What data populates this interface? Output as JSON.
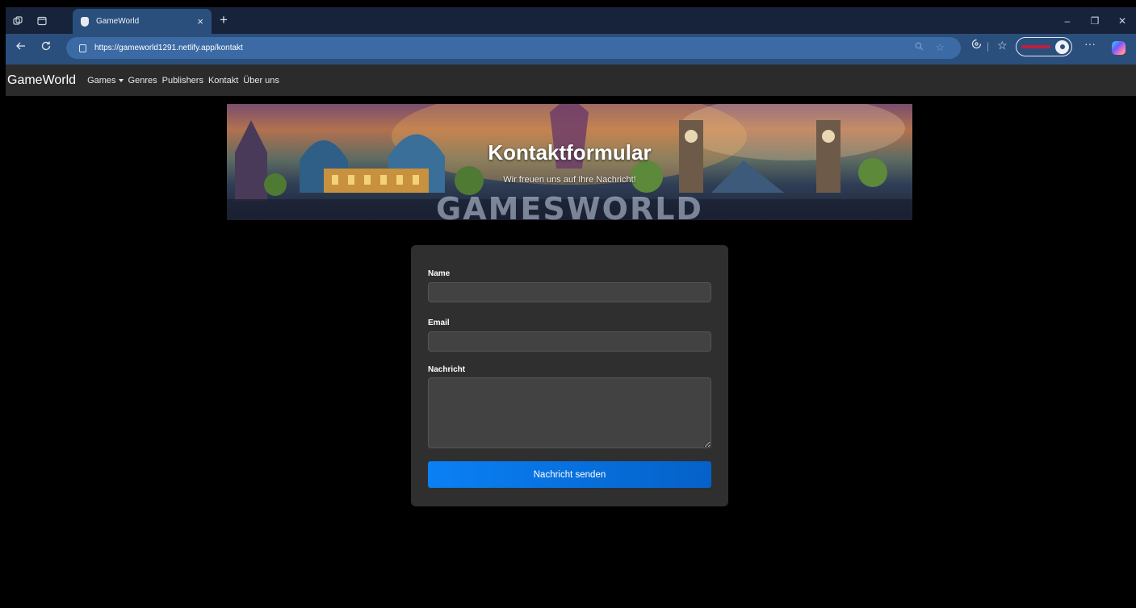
{
  "browser": {
    "tab_title": "GameWorld",
    "tab_close": "×",
    "new_tab": "+",
    "url": "https://gameworld1291.netlify.app/kontakt",
    "window_controls": {
      "minimize": "–",
      "restore": "❐",
      "close": "✕"
    },
    "icons": [
      "workspaces-icon",
      "tab-actions-icon",
      "back-icon",
      "refresh-icon",
      "lock-icon",
      "zoom-icon",
      "favorite-star-icon",
      "extensions-icon",
      "favorites-icon",
      "profile-avatar-icon",
      "more-icon",
      "copilot-icon"
    ],
    "colors": {
      "tabstrip": "#16233a",
      "toolbar": "#2b4f7c",
      "urlbox": "#3b6aa5"
    }
  },
  "nav": {
    "brand": "GameWorld",
    "links": [
      "Games",
      "Genres",
      "Publishers",
      "Kontakt",
      "Über uns"
    ]
  },
  "hero": {
    "title": "Kontaktformular",
    "subtitle": "Wir freuen uns auf Ihre Nachricht!",
    "banner_text": "GAMESWORLD"
  },
  "form": {
    "name_label": "Name",
    "email_label": "Email",
    "message_label": "Nachricht",
    "name_value": "",
    "email_value": "",
    "message_value": "",
    "submit_label": "Nachricht senden",
    "colors": {
      "card": "#2f2f2f",
      "input": "#424242",
      "button": "#0a80f5"
    }
  }
}
